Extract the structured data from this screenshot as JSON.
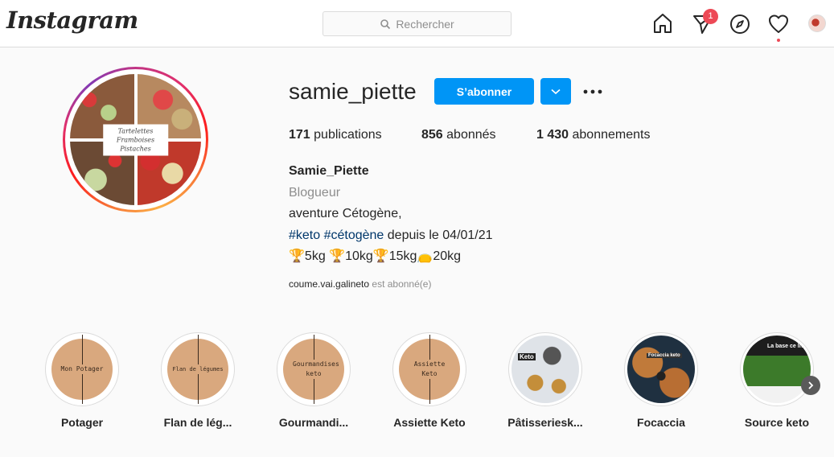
{
  "nav": {
    "logo": "Instagram",
    "search_placeholder": "Rechercher",
    "notification_count": "1",
    "icons": [
      "home-icon",
      "direct-icon",
      "explore-icon",
      "activity-heart-icon",
      "profile-avatar"
    ]
  },
  "profile": {
    "username": "samie_piette",
    "follow_label": "S’abonner",
    "avatar_text": "Tartelettes Framboises Pistaches",
    "stats": [
      {
        "count": "171",
        "label": "publications"
      },
      {
        "count": "856",
        "label": "abonnés"
      },
      {
        "count": "1 430",
        "label": "abonnements"
      }
    ],
    "bio": {
      "name": "Samie_Piette",
      "category": "Blogueur",
      "line1": "aventure Cétogène,",
      "tags": "#keto #cétogène",
      "line2_rest": " depuis le 04/01/21",
      "line3": "🏆5kg 🏆10kg🏆15kg👝20kg"
    },
    "followed_by_user": "coume.vai.galineto",
    "followed_by_text": " est abonné(e)"
  },
  "highlights": [
    {
      "label": "Potager",
      "cover": "Mon Potager"
    },
    {
      "label": "Flan de lég...",
      "cover": "Flan de légumes"
    },
    {
      "label": "Gourmandi...",
      "cover": "Gourmandises keto"
    },
    {
      "label": "Assiette Keto",
      "cover": "Assiette Keto"
    },
    {
      "label": "Pâtisseriesk...",
      "cover": "Keto"
    },
    {
      "label": "Focaccia",
      "cover": "Focaccia keto"
    },
    {
      "label": "Source keto",
      "cover": "La base ce livre"
    }
  ],
  "colors": {
    "accent": "#0095f6",
    "badge": "#ed4956",
    "hashtag": "#00376b",
    "muted": "#8e8e8e"
  }
}
